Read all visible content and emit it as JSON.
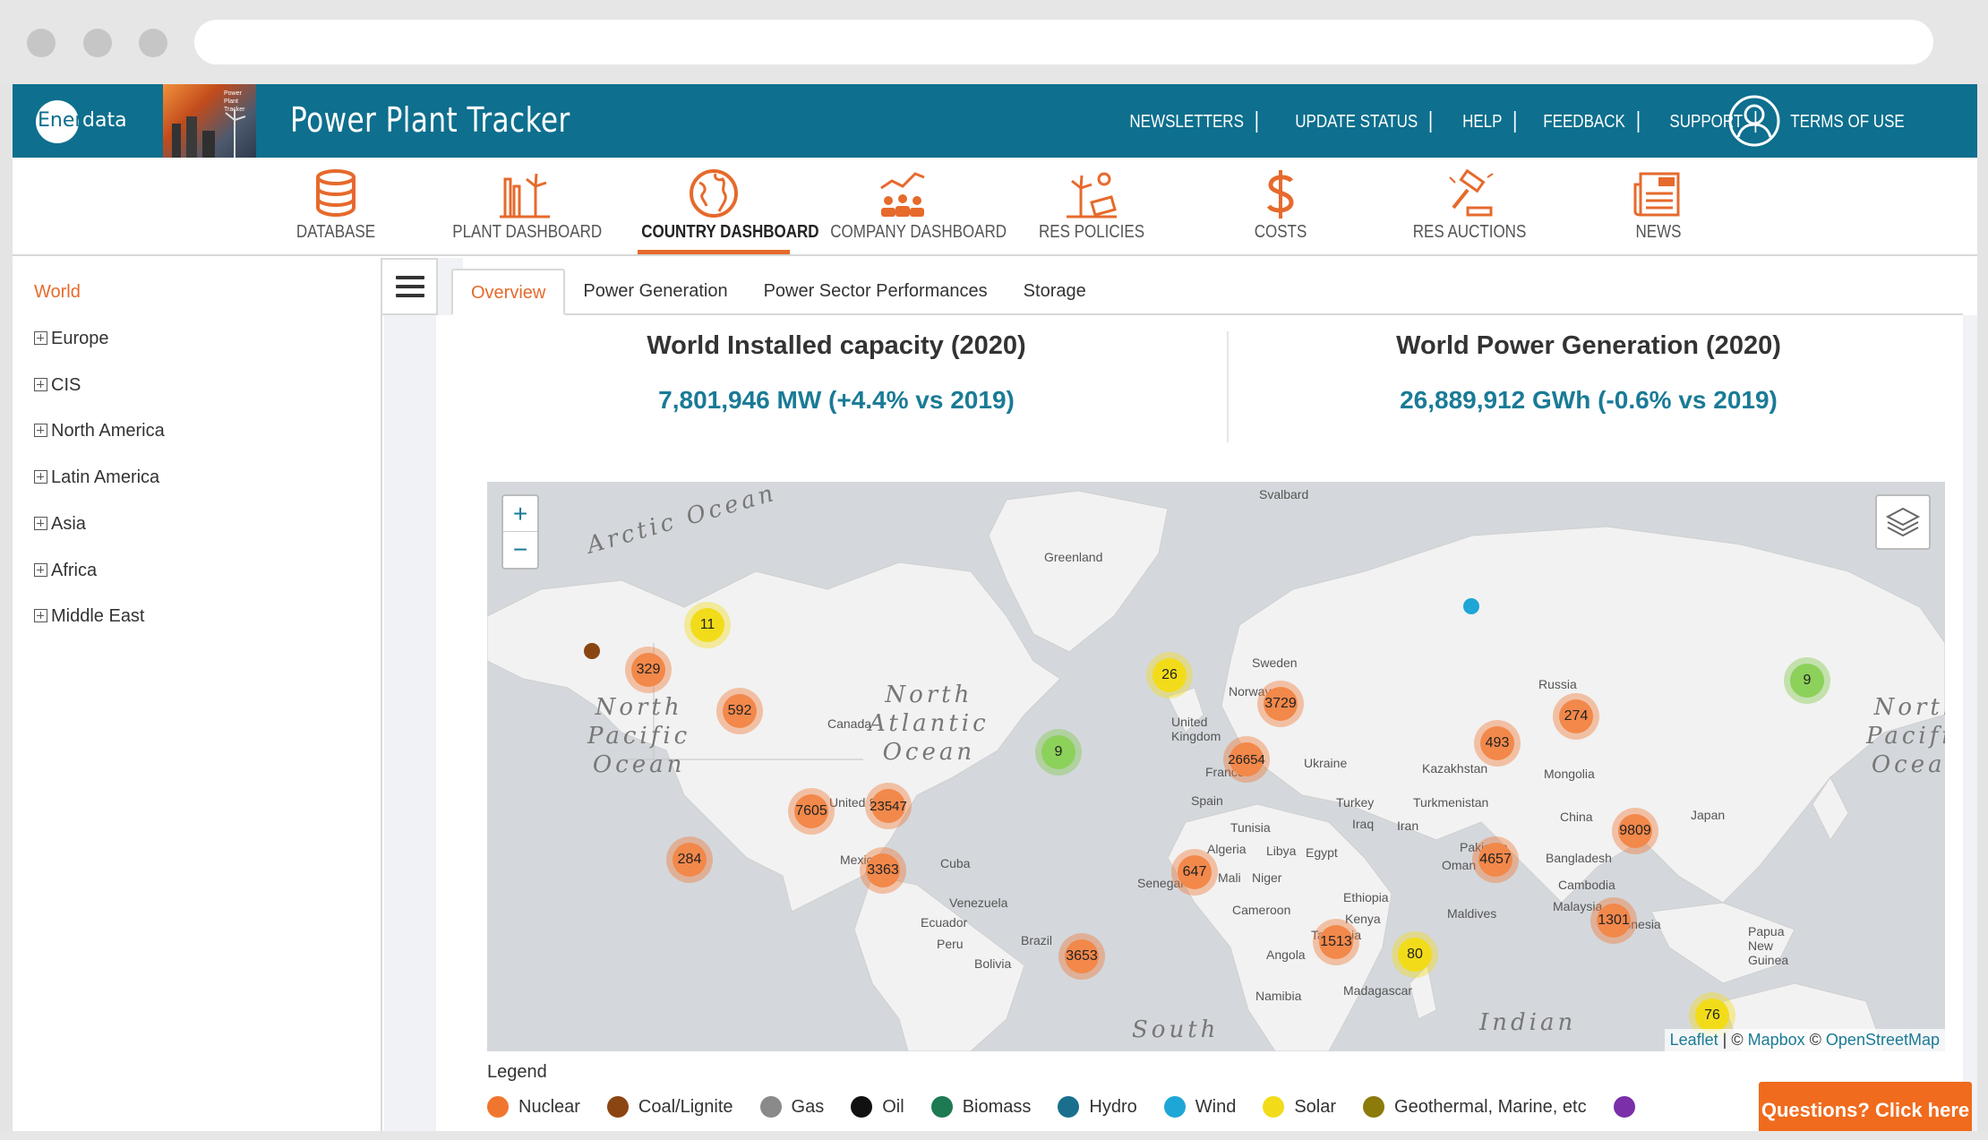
{
  "header": {
    "logo_prefix": "Ener",
    "logo_suffix": "data",
    "thumb_caption": "Power Plant Tracker",
    "app_title": "Power Plant Tracker",
    "links": [
      "NEWSLETTERS",
      "UPDATE STATUS",
      "HELP",
      "FEEDBACK",
      "SUPPORT",
      "TERMS OF USE"
    ]
  },
  "nav": {
    "items": [
      {
        "label": "DATABASE",
        "icon": "database-icon"
      },
      {
        "label": "PLANT DASHBOARD",
        "icon": "plant-icon"
      },
      {
        "label": "COUNTRY DASHBOARD",
        "icon": "globe-icon",
        "active": true
      },
      {
        "label": "COMPANY DASHBOARD",
        "icon": "company-icon"
      },
      {
        "label": "RES POLICIES",
        "icon": "res-policies-icon"
      },
      {
        "label": "COSTS",
        "icon": "dollar-icon"
      },
      {
        "label": "RES AUCTIONS",
        "icon": "auction-icon"
      },
      {
        "label": "NEWS",
        "icon": "news-icon"
      }
    ],
    "accent": "#e66a2c"
  },
  "sidebar": {
    "world": "World",
    "regions": [
      "Europe",
      "CIS",
      "North America",
      "Latin America",
      "Asia",
      "Africa",
      "Middle East"
    ]
  },
  "tabs": [
    "Overview",
    "Power Generation",
    "Power Sector Performances",
    "Storage"
  ],
  "stats": {
    "capacity_title": "World Installed capacity (2020)",
    "capacity_value": "7,801,946 MW (+4.4% vs 2019)",
    "generation_title": "World Power Generation (2020)",
    "generation_value": "26,889,912 GWh (-0.6% vs 2019)"
  },
  "map": {
    "zoom_in": "+",
    "zoom_out": "−",
    "labels": [
      "Svalbard",
      "Greenland",
      "Sweden",
      "Norway",
      "Russia",
      "United Kingdom",
      "Canada",
      "France",
      "Ukraine",
      "Kazakhstan",
      "Mongolia",
      "Spain",
      "Turkey",
      "Turkmenistan",
      "United States",
      "Tunisia",
      "Iraq",
      "Iran",
      "China",
      "Japan",
      "Algeria",
      "Libya",
      "Egypt",
      "Pakistan",
      "Mexico",
      "Oman",
      "Bangladesh",
      "Cuba",
      "Senegal",
      "Mali",
      "Niger",
      "Venezuela",
      "Ethiopia",
      "Cambodia",
      "Cameroon",
      "Maldives",
      "Malaysia",
      "Ecuador",
      "Kenya",
      "Tanzania",
      "Indonesia",
      "Papua New Guinea",
      "Peru",
      "Brazil",
      "Angola",
      "Bolivia",
      "Namibia",
      "Madagascar"
    ],
    "oceans": {
      "arctic": "Arctic Ocean",
      "north_pacific_1": "North\nPacific\nOcean",
      "north_atlantic": "North\nAtlantic\nOcean",
      "north_pacific_2": "North\nPacific\nOcean",
      "indian": "Indian",
      "south": "South"
    },
    "clusters": [
      {
        "value": "11",
        "color": "solar"
      },
      {
        "value": "329",
        "color": "nuclear"
      },
      {
        "value": "592",
        "color": "nuclear"
      },
      {
        "value": "26",
        "color": "solar"
      },
      {
        "value": "3729",
        "color": "nuclear"
      },
      {
        "value": "9",
        "color": "green"
      },
      {
        "value": "9",
        "color": "green"
      },
      {
        "value": "274",
        "color": "nuclear"
      },
      {
        "value": "493",
        "color": "nuclear"
      },
      {
        "value": "26654",
        "color": "nuclear"
      },
      {
        "value": "7605",
        "color": "nuclear"
      },
      {
        "value": "23547",
        "color": "nuclear"
      },
      {
        "value": "9809",
        "color": "nuclear"
      },
      {
        "value": "4657",
        "color": "nuclear"
      },
      {
        "value": "284",
        "color": "nuclear"
      },
      {
        "value": "3363",
        "color": "nuclear"
      },
      {
        "value": "647",
        "color": "nuclear"
      },
      {
        "value": "1513",
        "color": "nuclear"
      },
      {
        "value": "1301",
        "color": "nuclear"
      },
      {
        "value": "80",
        "color": "solar"
      },
      {
        "value": "3653",
        "color": "nuclear"
      },
      {
        "value": "76",
        "color": "solar"
      }
    ],
    "attribution": {
      "leaflet": "Leaflet",
      "sep1": " | © ",
      "mapbox": "Mapbox",
      "sep2": " © ",
      "osm": "OpenStreetMap"
    }
  },
  "legend": {
    "title": "Legend",
    "items": [
      {
        "label": "Nuclear",
        "color": "#f0762f"
      },
      {
        "label": "Coal/Lignite",
        "color": "#8b4513"
      },
      {
        "label": "Gas",
        "color": "#8a8a8a"
      },
      {
        "label": "Oil",
        "color": "#111111"
      },
      {
        "label": "Biomass",
        "color": "#1e7a52"
      },
      {
        "label": "Hydro",
        "color": "#1a6f8e"
      },
      {
        "label": "Wind",
        "color": "#1ea6d6"
      },
      {
        "label": "Solar",
        "color": "#f2dc1a"
      },
      {
        "label": "Geothermal, Marine, etc",
        "color": "#8c7a0a"
      }
    ]
  },
  "help_button": "Questions? Click here"
}
